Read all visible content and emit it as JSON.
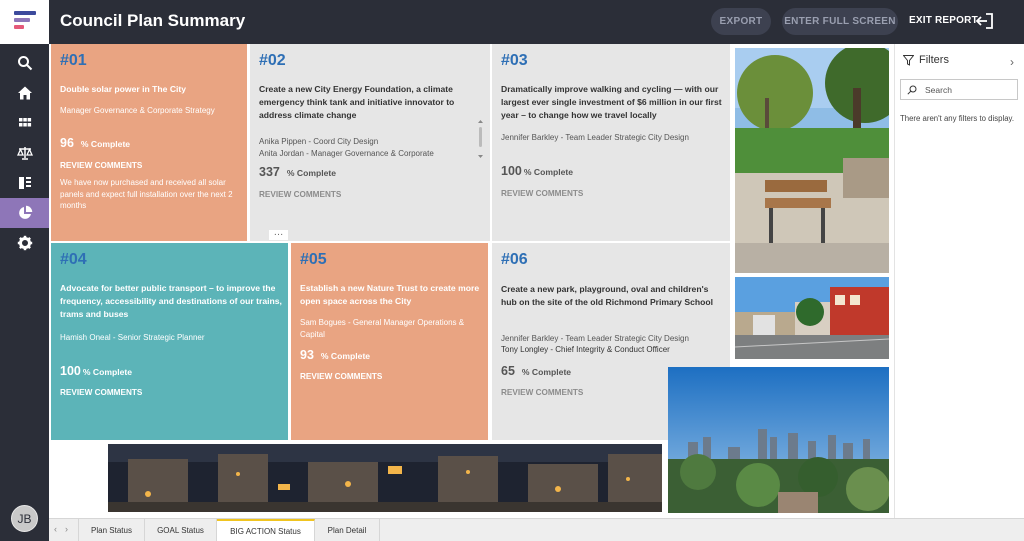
{
  "header": {
    "title": "Council Plan Summary",
    "export_label": "EXPORT",
    "fullscreen_label": "ENTER FULL SCREEN",
    "exit_label": "EXIT REPORT"
  },
  "nav": {
    "items": [
      "search-icon",
      "home-icon",
      "apps-icon",
      "scale-icon",
      "list-icon",
      "pie-chart-icon",
      "gear-icon"
    ],
    "active": "pie-chart-icon",
    "avatar_initials": "JB"
  },
  "cards": [
    {
      "num": "#01",
      "headline": "Double solar power in The City",
      "owners": [
        "Manager Governance & Corporate Strategy"
      ],
      "percent_value": "96",
      "percent_label": "% Complete",
      "review": "REVIEW COMMENTS",
      "note": "We have now purchased and received all solar panels and expect full installation over the next 2 months"
    },
    {
      "num": "#02",
      "headline": "Create a new City Energy Foundation, a climate emergency think tank and initiative innovator to address climate change",
      "owners": [
        "Anika Pippen - Coord City Design",
        "Anita Jordan - Manager Governance & Corporate"
      ],
      "percent_value": "337",
      "percent_label": "% Complete",
      "review": "REVIEW COMMENTS"
    },
    {
      "num": "#03",
      "headline": "Dramatically improve walking and cycling — with our largest ever single investment of $6 million in our first year – to change how we travel locally",
      "owners": [
        "Jennifer Barkley - Team Leader Strategic City Design"
      ],
      "percent_value": "100",
      "percent_label": "% Complete",
      "review": "REVIEW COMMENTS"
    },
    {
      "num": "#04",
      "headline": "Advocate for better public transport – to improve the frequency, accessibility and destinations of our trains, trams and buses",
      "owners": [
        "Hamish Oneal - Senior Strategic Planner"
      ],
      "percent_value": "100",
      "percent_label": "% Complete",
      "review": "REVIEW COMMENTS"
    },
    {
      "num": "#05",
      "headline": "Establish a new Nature Trust to create more open space across the City",
      "owners": [
        "Sam Bogues - General Manager Operations & Capital"
      ],
      "percent_value": "93",
      "percent_label": "% Complete",
      "review": "REVIEW COMMENTS"
    },
    {
      "num": "#06",
      "headline": "Create a new park, playground, oval and children's hub on the site of the old Richmond Primary School",
      "owners": [
        "Jennifer Barkley - Team Leader Strategic City Design",
        "Tony Longley - Chief Integrity & Conduct Officer"
      ],
      "percent_value": "65",
      "percent_label": "% Complete",
      "review": "REVIEW COMMENTS"
    }
  ],
  "filters": {
    "title": "Filters",
    "search_placeholder": "Search",
    "empty_text": "There aren't any filters to display."
  },
  "tabs": [
    {
      "label": "Plan Status"
    },
    {
      "label": "GOAL Status"
    },
    {
      "label": "BIG ACTION Status",
      "active": true
    },
    {
      "label": "Plan Detail"
    }
  ],
  "colors": {
    "nav_bg": "#2b2e38",
    "orange_card": "#e9a482",
    "teal_card": "#5cb4b8",
    "grey_card": "#e6e6e6",
    "number_blue": "#2e6fb5",
    "nav_active": "#8e76b8",
    "active_tab_accent": "#f0c420"
  }
}
